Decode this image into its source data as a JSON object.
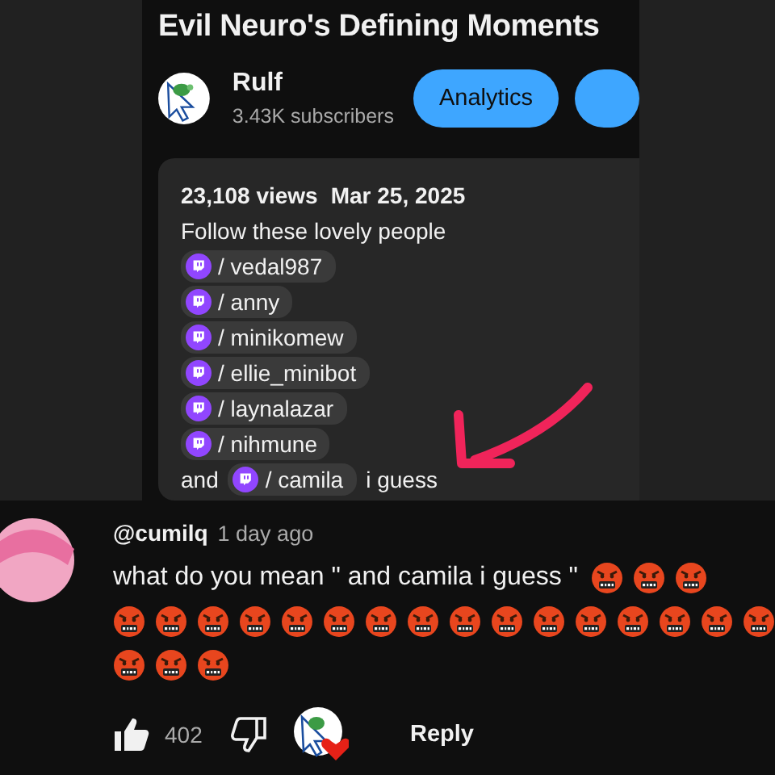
{
  "video": {
    "title": "Evil Neuro's Defining Moments"
  },
  "channel": {
    "name": "Rulf",
    "subscribers": "3.43K subscribers"
  },
  "buttons": [
    {
      "label": "Analytics"
    }
  ],
  "description": {
    "views": "23,108 views",
    "date": "Mar 25, 2025",
    "intro": "Follow these lovely people",
    "links": [
      {
        "label": "/ vedal987"
      },
      {
        "label": "/ anny"
      },
      {
        "label": "/ minikomew"
      },
      {
        "label": "/ ellie_minibot"
      },
      {
        "label": "/ laynalazar"
      },
      {
        "label": "/ nihmune"
      }
    ],
    "closing": {
      "before": "and",
      "link": "/ camila",
      "after": "i guess"
    }
  },
  "comment": {
    "author": "@cumilq",
    "time": "1 day ago",
    "likes": "402",
    "hearted": true,
    "reply": "Reply",
    "lines": [
      {
        "text": "what do you mean \" and camila i guess \"",
        "emojis": [
          {
            "kind": "swearing-face"
          },
          {
            "kind": "swearing-face"
          },
          {
            "kind": "swearing-face"
          }
        ]
      },
      {
        "emojis": [
          {
            "kind": "swearing-face"
          },
          {
            "kind": "swearing-face"
          },
          {
            "kind": "swearing-face"
          },
          {
            "kind": "swearing-face"
          },
          {
            "kind": "swearing-face"
          },
          {
            "kind": "swearing-face"
          },
          {
            "kind": "swearing-face"
          },
          {
            "kind": "swearing-face"
          },
          {
            "kind": "swearing-face"
          },
          {
            "kind": "swearing-face"
          },
          {
            "kind": "swearing-face"
          },
          {
            "kind": "swearing-face"
          },
          {
            "kind": "swearing-face"
          },
          {
            "kind": "swearing-face"
          },
          {
            "kind": "swearing-face"
          },
          {
            "kind": "swearing-face"
          }
        ]
      },
      {
        "emojis": [
          {
            "kind": "swearing-face"
          },
          {
            "kind": "swearing-face"
          },
          {
            "kind": "swearing-face"
          }
        ]
      }
    ]
  }
}
